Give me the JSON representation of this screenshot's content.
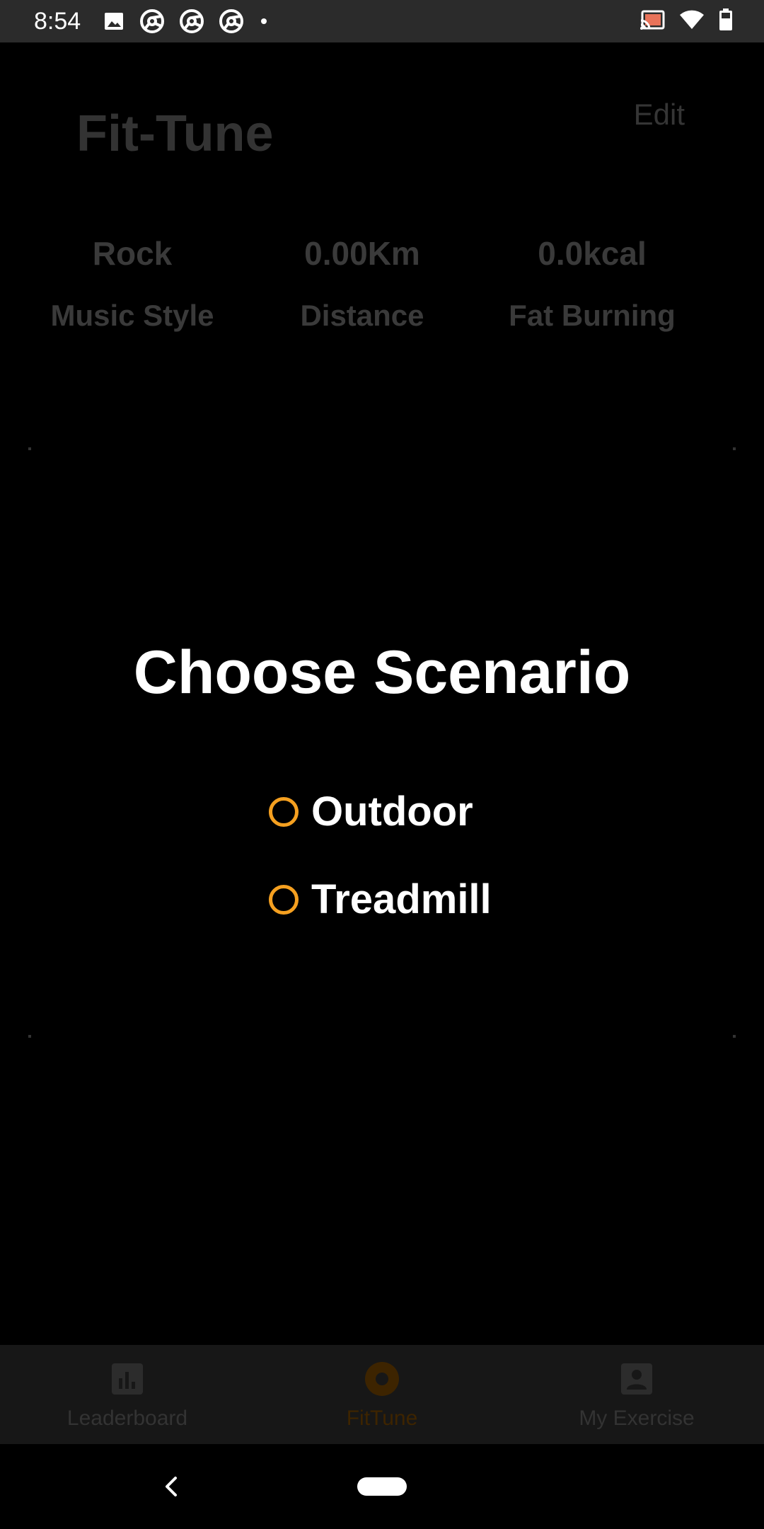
{
  "status_bar": {
    "time": "8:54",
    "left_icons": [
      "image-icon",
      "chrome-icon",
      "chrome-icon",
      "chrome-icon",
      "dot-icon"
    ],
    "right_icons": [
      "cast-icon",
      "wifi-icon",
      "battery-icon"
    ]
  },
  "app": {
    "title": "Fit-Tune",
    "edit_label": "Edit"
  },
  "stats": [
    {
      "value": "Rock",
      "label": "Music Style"
    },
    {
      "value": "0.00Km",
      "label": "Distance"
    },
    {
      "value": "0.0kcal",
      "label": "Fat Burning"
    }
  ],
  "dialog": {
    "title": "Choose Scenario",
    "options": [
      {
        "label": "Outdoor",
        "selected": false
      },
      {
        "label": "Treadmill",
        "selected": false
      }
    ],
    "accent_color": "#f5a020"
  },
  "bottom_nav": {
    "items": [
      {
        "label": "Leaderboard",
        "icon": "bar-chart-icon",
        "active": false
      },
      {
        "label": "FitTune",
        "icon": "fittune-icon",
        "active": true
      },
      {
        "label": "My Exercise",
        "icon": "person-icon",
        "active": false
      }
    ]
  },
  "system_nav": {
    "back_icon": "back-chevron-icon",
    "home_icon": "home-pill-icon"
  }
}
